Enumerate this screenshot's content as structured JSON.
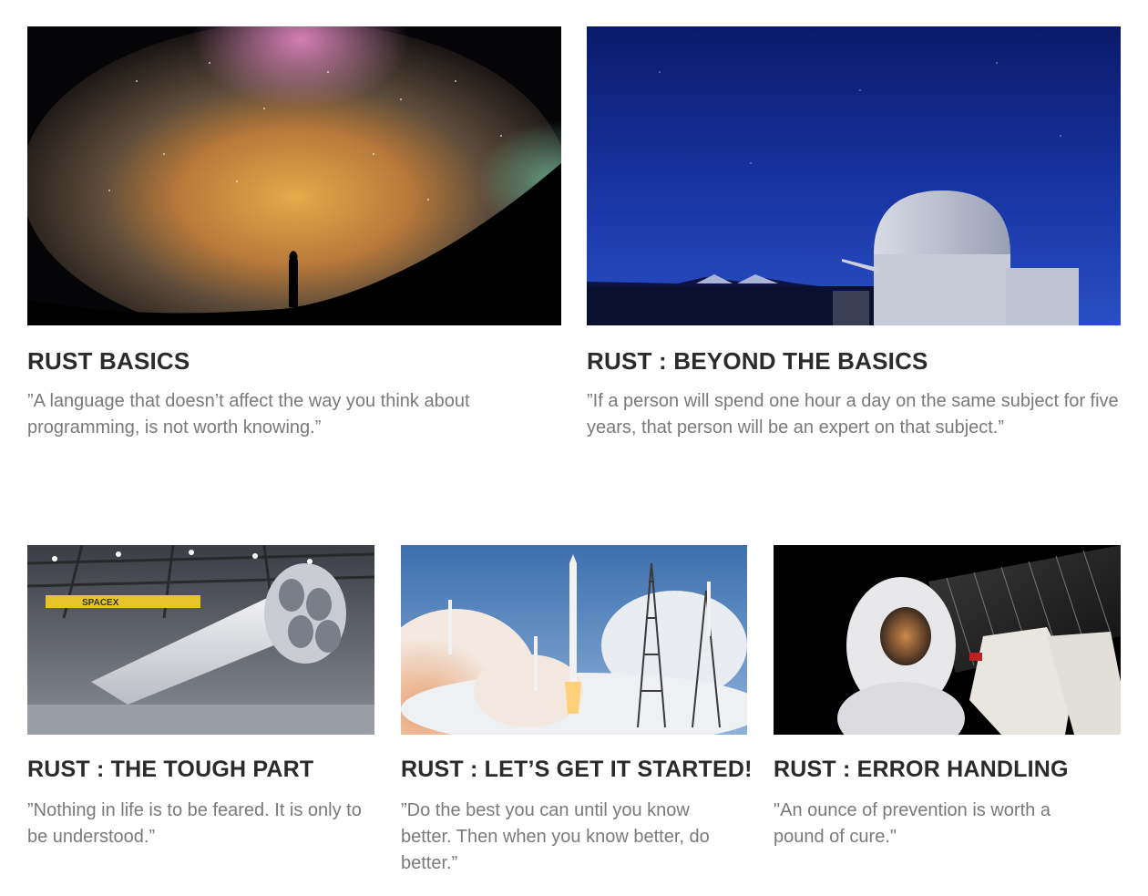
{
  "courses": [
    {
      "title": "RUST BASICS",
      "quote": "”A language that doesn’t affect the way you think about programming, is not worth knowing.”",
      "image": "milky-way-night-sky-photo"
    },
    {
      "title": "RUST : BEYOND THE BASICS",
      "quote": "”If a person will spend one hour a day on the same subject for five years, that person will be an expert on that subject.”",
      "image": "observatory-dome-night-photo"
    },
    {
      "title": "RUST : THE TOUGH PART",
      "quote": "”Nothing in life is to be feared. It is only to be understood.”",
      "image": "rocket-hangar-photo",
      "image_text": "SPACEX"
    },
    {
      "title": "RUST : LET’S GET IT STARTED!",
      "quote": "”Do the best you can until you know better. Then when you know better, do better.”",
      "image": "rocket-launch-photo"
    },
    {
      "title": "RUST : ERROR HANDLING",
      "quote": "\"An ounce of prevention is worth a pound of cure.\"",
      "image": "astronaut-spacewalk-photo"
    }
  ],
  "colors": {
    "title": "#2b2b2b",
    "quote": "#7a7a7a",
    "background": "#ffffff"
  }
}
